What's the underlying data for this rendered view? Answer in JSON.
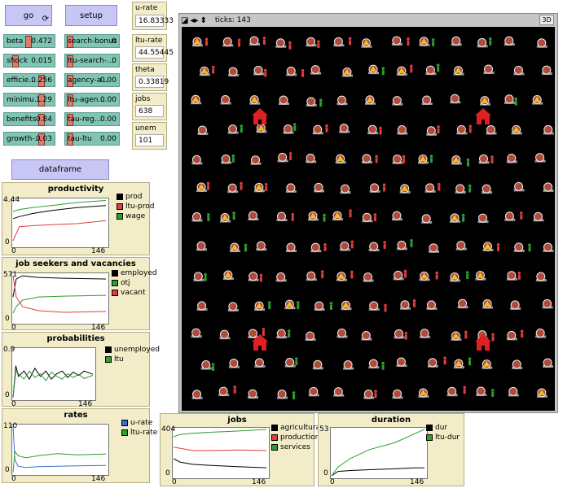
{
  "buttons": {
    "go": "go",
    "setup": "setup",
    "dataframe": "dataframe"
  },
  "sliders": [
    {
      "label": "beta",
      "value": "0.472",
      "pos": 0.47
    },
    {
      "label": "shock",
      "value": "0.015",
      "pos": 0.15
    },
    {
      "label": "efficie...",
      "value": "0.256",
      "pos": 0.8
    },
    {
      "label": "minimu...",
      "value": "1.29",
      "pos": 0.8
    },
    {
      "label": "benefits",
      "value": "0.84",
      "pos": 0.8
    },
    {
      "label": "growth-...",
      "value": "0.03",
      "pos": 0.8
    },
    {
      "label": "search-bonus",
      "value": "0",
      "pos": 0.0
    },
    {
      "label": "ltu-search-...",
      "value": "0",
      "pos": 0.0
    },
    {
      "label": "agency-a...",
      "value": "0.00",
      "pos": 0.0
    },
    {
      "label": "ltu-agen...",
      "value": "0.00",
      "pos": 0.0
    },
    {
      "label": "tau-reg...",
      "value": "0.00",
      "pos": 0.0
    },
    {
      "label": "tau-ltu",
      "value": "0.00",
      "pos": 0.0
    }
  ],
  "monitors": [
    {
      "label": "u-rate",
      "value": "16.83333"
    },
    {
      "label": "ltu-rate",
      "value": "44.55445"
    },
    {
      "label": "theta",
      "value": "0.33819"
    },
    {
      "label": "jobs",
      "value": "638"
    },
    {
      "label": "unem",
      "value": "101"
    }
  ],
  "view": {
    "ticks_label": "ticks: 143",
    "btn_3d": "3D"
  },
  "colors": {
    "black": "#000000",
    "red": "#e23c3c",
    "green": "#2e9e2e",
    "blue": "#3a6fd0",
    "plot_bg": "#f2ecc8",
    "slider": "#80c4b4",
    "button": "#c8c6f4"
  },
  "plots": [
    {
      "title": "productivity",
      "ymax": "4.44",
      "ymin": "0",
      "xmin": "0",
      "xmax": "146",
      "legend": [
        {
          "label": "prod",
          "color": "#000000"
        },
        {
          "label": "ltu-prod",
          "color": "#e23c3c"
        },
        {
          "label": "wage",
          "color": "#2e9e2e"
        }
      ]
    },
    {
      "title": "job seekers and vacancies",
      "ymax": "571",
      "ymin": "0",
      "xmin": "0",
      "xmax": "146",
      "legend": [
        {
          "label": "employed",
          "color": "#000000"
        },
        {
          "label": "otj",
          "color": "#2e9e2e"
        },
        {
          "label": "vacant",
          "color": "#e23c3c"
        }
      ]
    },
    {
      "title": "probabilities",
      "ymax": "0.9",
      "ymin": "0",
      "xmin": "0",
      "xmax": "146",
      "legend": [
        {
          "label": "unemployed",
          "color": "#000000"
        },
        {
          "label": "ltu",
          "color": "#2e9e2e"
        }
      ]
    },
    {
      "title": "rates",
      "ymax": "110",
      "ymin": "0",
      "xmin": "0",
      "xmax": "146",
      "legend": [
        {
          "label": "u-rate",
          "color": "#3a6fd0"
        },
        {
          "label": "ltu-rate",
          "color": "#2e9e2e"
        }
      ]
    },
    {
      "title": "jobs",
      "ymax": "404",
      "ymin": "0",
      "xmin": "0",
      "xmax": "146",
      "legend": [
        {
          "label": "agricultural",
          "color": "#000000"
        },
        {
          "label": "production",
          "color": "#e23c3c"
        },
        {
          "label": "services",
          "color": "#2e9e2e"
        }
      ]
    },
    {
      "title": "duration",
      "ymax": "53",
      "ymin": "0",
      "xmin": "0",
      "xmax": "146",
      "legend": [
        {
          "label": "dur",
          "color": "#000000"
        },
        {
          "label": "ltu-dur",
          "color": "#2e9e2e"
        }
      ]
    }
  ],
  "chart_data": [
    {
      "type": "line",
      "x": [
        0,
        10,
        30,
        60,
        100,
        146
      ],
      "ylim": [
        0,
        4.44
      ],
      "series": [
        {
          "name": "prod",
          "color": "#000000",
          "values": [
            2.6,
            2.8,
            3.1,
            3.4,
            3.7,
            3.9
          ]
        },
        {
          "name": "ltu-prod",
          "color": "#e23c3c",
          "values": [
            0.4,
            1.8,
            1.9,
            2.0,
            2.1,
            2.4
          ]
        },
        {
          "name": "wage",
          "color": "#2e9e2e",
          "values": [
            3.3,
            3.5,
            3.7,
            3.9,
            4.2,
            4.4
          ]
        }
      ]
    },
    {
      "type": "line",
      "x": [
        0,
        5,
        15,
        40,
        80,
        146
      ],
      "ylim": [
        0,
        571
      ],
      "series": [
        {
          "name": "employed",
          "color": "#000000",
          "values": [
            300,
            520,
            560,
            540,
            530,
            520
          ]
        },
        {
          "name": "otj",
          "color": "#2e9e2e",
          "values": [
            100,
            180,
            260,
            300,
            310,
            320
          ]
        },
        {
          "name": "vacant",
          "color": "#e23c3c",
          "values": [
            560,
            300,
            180,
            130,
            110,
            120
          ]
        }
      ]
    },
    {
      "type": "line",
      "x": [
        0,
        5,
        10,
        20,
        30,
        40,
        50,
        60,
        70,
        80,
        90,
        100,
        110,
        120,
        130,
        146
      ],
      "ylim": [
        0,
        0.9
      ],
      "series": [
        {
          "name": "unemployed",
          "color": "#000000",
          "values": [
            0.0,
            0.6,
            0.4,
            0.5,
            0.35,
            0.55,
            0.4,
            0.5,
            0.35,
            0.45,
            0.5,
            0.38,
            0.48,
            0.42,
            0.5,
            0.44
          ]
        },
        {
          "name": "ltu",
          "color": "#2e9e2e",
          "values": [
            0.0,
            0.5,
            0.45,
            0.35,
            0.5,
            0.38,
            0.45,
            0.32,
            0.48,
            0.4,
            0.35,
            0.45,
            0.38,
            0.44,
            0.36,
            0.42
          ]
        }
      ]
    },
    {
      "type": "line",
      "x": [
        0,
        3,
        8,
        20,
        40,
        70,
        100,
        146
      ],
      "ylim": [
        0,
        110
      ],
      "series": [
        {
          "name": "u-rate",
          "color": "#3a6fd0",
          "values": [
            110,
            30,
            15,
            12,
            14,
            15,
            16,
            17
          ]
        },
        {
          "name": "ltu-rate",
          "color": "#2e9e2e",
          "values": [
            0,
            50,
            40,
            35,
            40,
            45,
            42,
            44
          ]
        }
      ]
    },
    {
      "type": "line",
      "x": [
        0,
        10,
        30,
        60,
        100,
        146
      ],
      "ylim": [
        0,
        404
      ],
      "series": [
        {
          "name": "agricultural",
          "color": "#000000",
          "values": [
            150,
            120,
            100,
            90,
            80,
            70
          ]
        },
        {
          "name": "production",
          "color": "#e23c3c",
          "values": [
            250,
            240,
            220,
            220,
            225,
            220
          ]
        },
        {
          "name": "services",
          "color": "#2e9e2e",
          "values": [
            340,
            360,
            370,
            380,
            390,
            404
          ]
        }
      ]
    },
    {
      "type": "line",
      "x": [
        0,
        10,
        30,
        60,
        100,
        130,
        146
      ],
      "ylim": [
        0,
        53
      ],
      "series": [
        {
          "name": "dur",
          "color": "#000000",
          "values": [
            0,
            5,
            6,
            7,
            8,
            9,
            9
          ]
        },
        {
          "name": "ltu-dur",
          "color": "#2e9e2e",
          "values": [
            0,
            10,
            20,
            30,
            38,
            48,
            53
          ]
        }
      ]
    }
  ]
}
